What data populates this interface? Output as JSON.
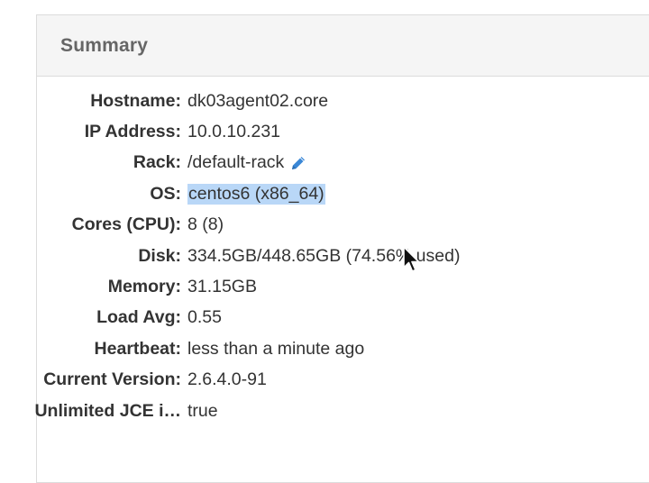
{
  "panel": {
    "title": "Summary"
  },
  "summary": {
    "hostname": {
      "label": "Hostname:",
      "value": "dk03agent02.core"
    },
    "ip_address": {
      "label": "IP Address:",
      "value": "10.0.10.231"
    },
    "rack": {
      "label": "Rack:",
      "value": "/default-rack",
      "icon": "pencil-edit-icon"
    },
    "os": {
      "label": "OS:",
      "value": "centos6 (x86_64)"
    },
    "cores": {
      "label": "Cores (CPU):",
      "value": "8 (8)"
    },
    "disk": {
      "label": "Disk:",
      "value": "334.5GB/448.65GB (74.56% used)"
    },
    "memory": {
      "label": "Memory:",
      "value": "31.15GB"
    },
    "load_avg": {
      "label": "Load Avg:",
      "value": "0.55"
    },
    "heartbeat": {
      "label": "Heartbeat:",
      "value": "less than a minute ago"
    },
    "current_version": {
      "label": "Current Version:",
      "value": "2.6.4.0-91"
    },
    "unlimited_jce": {
      "label": "Unlimited JCE i…",
      "value": "true"
    }
  },
  "colors": {
    "header_bg": "#f5f5f5",
    "border": "#dcdcdc",
    "selection": "#b9d7f7",
    "edit_icon": "#3a87d6"
  }
}
